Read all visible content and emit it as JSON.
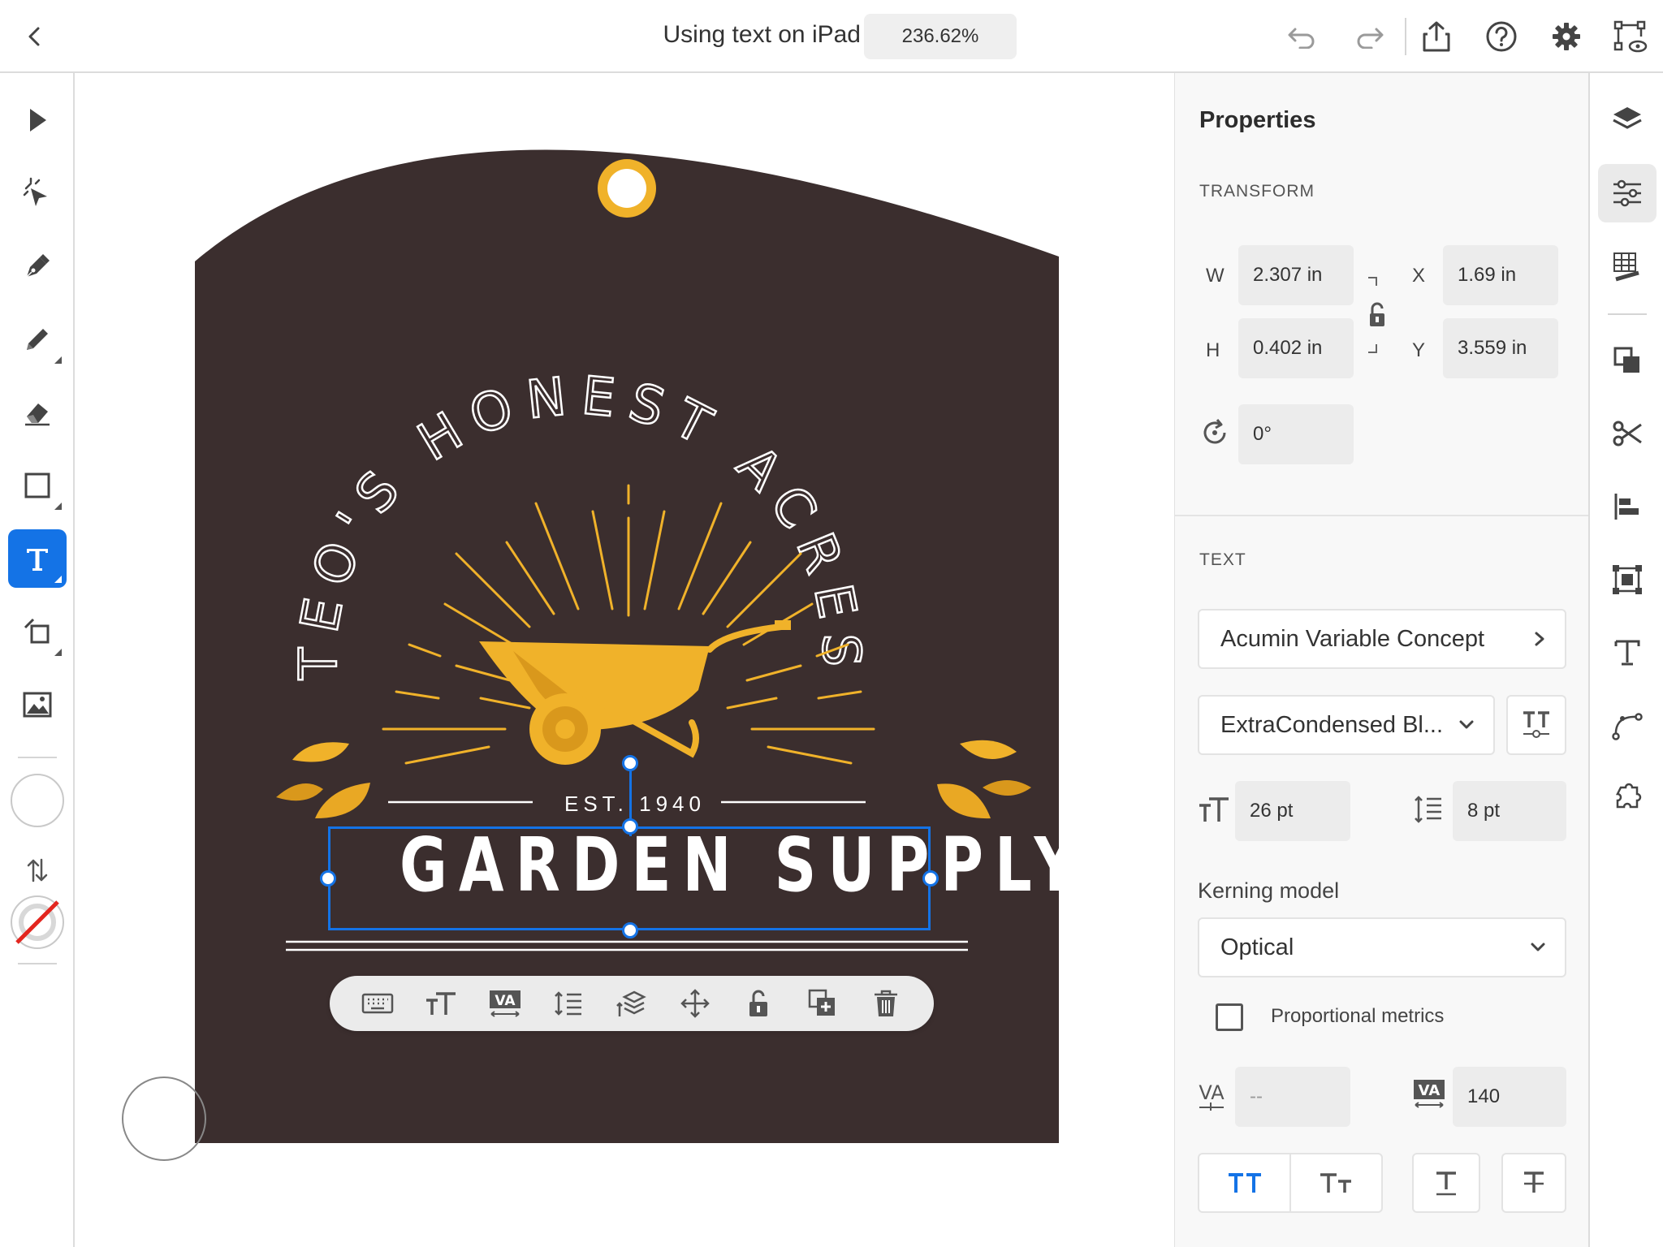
{
  "topbar": {
    "doc_title": "Using text on iPad",
    "zoom": "236.62%"
  },
  "artwork": {
    "arc_text": "TEO'S HONEST ACRES",
    "est": "EST. 1940",
    "headline": "GARDEN SUPPLY",
    "colors": {
      "tag": "#3b2e2e",
      "accent": "#f0b22a",
      "text": "#ffffff"
    }
  },
  "properties": {
    "title": "Properties",
    "transform": {
      "label": "TRANSFORM",
      "w_label": "W",
      "w": "2.307 in",
      "h_label": "H",
      "h": "0.402 in",
      "x_label": "X",
      "x": "1.69 in",
      "y_label": "Y",
      "y": "3.559 in",
      "rotation": "0°"
    },
    "text": {
      "label": "TEXT",
      "font_family": "Acumin Variable Concept",
      "font_style": "ExtraCondensed Bl...",
      "font_size": "26 pt",
      "leading": "8 pt",
      "kerning_label": "Kerning model",
      "kerning": "Optical",
      "proportional_label": "Proportional metrics",
      "kerning_value": "--",
      "tracking": "140"
    }
  },
  "colors": {
    "selection": "#1473e6",
    "panel_bg": "#f8f8f8",
    "field_bg": "#ececec"
  }
}
